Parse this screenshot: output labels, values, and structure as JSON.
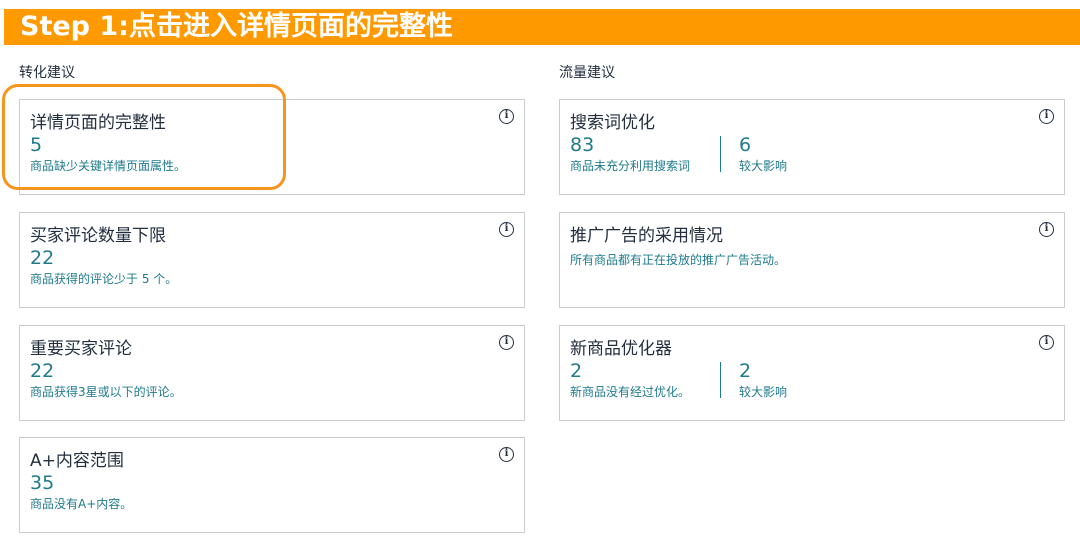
{
  "banner": {
    "text": "Step 1:点击进入详情页面的完整性"
  },
  "sections": {
    "conversion": "转化建议",
    "traffic": "流量建议"
  },
  "left_cards": [
    {
      "title": "详情页面的完整性",
      "value": "5",
      "desc": "商品缺少关键详情页面属性。"
    },
    {
      "title": "买家评论数量下限",
      "value": "22",
      "desc": "商品获得的评论少于 5 个。"
    },
    {
      "title": "重要买家评论",
      "value": "22",
      "desc": "商品获得3星或以下的评论。"
    },
    {
      "title": "A+内容范围",
      "value": "35",
      "desc": "商品没有A+内容。"
    }
  ],
  "right_cards": [
    {
      "title": "搜索词优化",
      "value": "83",
      "desc": "商品未充分利用搜索词",
      "value2": "6",
      "desc2": "较大影响"
    },
    {
      "title": "推广广告的采用情况",
      "desc": "所有商品都有正在投放的推广广告活动。"
    },
    {
      "title": "新商品优化器",
      "value": "2",
      "desc": "新商品没有经过优化。",
      "value2": "2",
      "desc2": "较大影响"
    }
  ],
  "icons": {
    "info": "i"
  },
  "colors": {
    "banner": "#ff9900",
    "highlight": "#f7941d",
    "accent": "#1f7a8c"
  }
}
